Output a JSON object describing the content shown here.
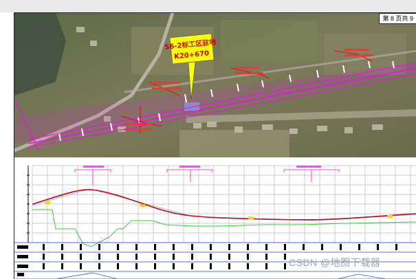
{
  "sheet": {
    "page_label": "第 8 页共 9",
    "site_callout": {
      "title": "S6-2标工区驻地",
      "station": "K20+670"
    }
  },
  "colors": {
    "route_line": "#ff00ff",
    "callout_fill": "#ffff00",
    "design_grade": "#cc0000",
    "ground_line": "#33cc33",
    "grid": "#999999",
    "station_blue": "#0000ff"
  },
  "watermark": "CSDN @地图下载器"
}
